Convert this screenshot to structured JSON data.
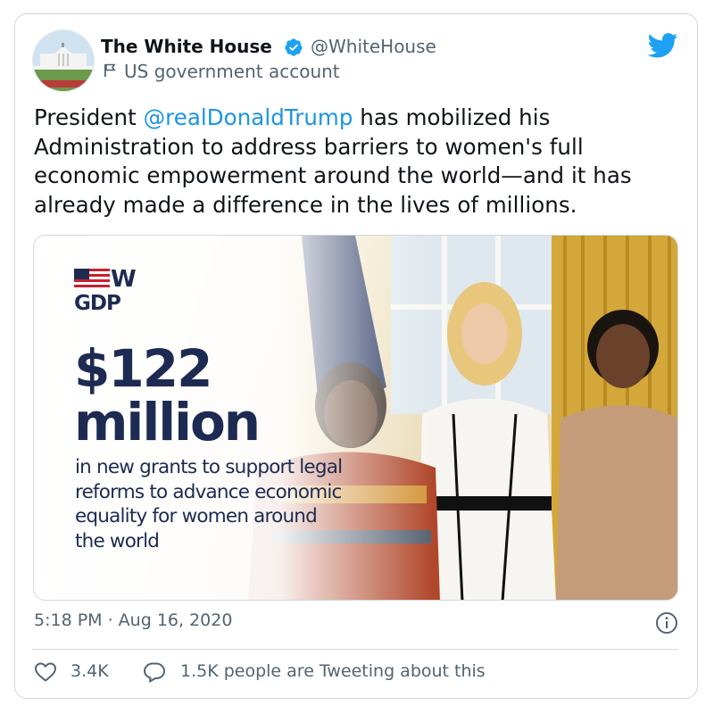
{
  "author": {
    "display_name": "The White House",
    "handle": "@WhiteHouse",
    "account_label": "US government account"
  },
  "tweet": {
    "text_before": "President ",
    "mention": "@realDonaldTrump",
    "text_after": " has mobilized his Administration to address barriers to women's full economic empowerment around the world—and it has already made a difference in the lives of millions."
  },
  "media": {
    "logo_text": "GDP",
    "logo_letter": "W",
    "amount_line1": "$122",
    "amount_line2": "million",
    "caption": "in new grants to support legal reforms to advance economic equality for women around the world"
  },
  "meta": {
    "timestamp": "5:18 PM · Aug 16, 2020"
  },
  "actions": {
    "likes": "3.4K",
    "tweeting": "1.5K people are Tweeting about this"
  },
  "colors": {
    "brand": "#1da1f2",
    "mention": "#1b95e0",
    "navy": "#1d2b53"
  },
  "icons": [
    "verified-icon",
    "flag-icon",
    "twitter-bird-icon",
    "info-icon",
    "heart-icon",
    "reply-bubble-icon"
  ]
}
